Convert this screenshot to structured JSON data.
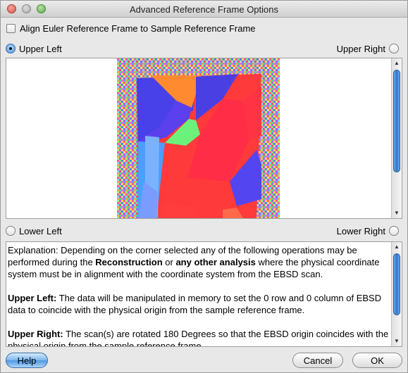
{
  "window": {
    "title": "Advanced Reference Frame Options"
  },
  "options": {
    "align_checkbox_label": "Align Euler Reference Frame to Sample Reference Frame",
    "align_checked": false
  },
  "corners": {
    "upper_left": "Upper Left",
    "upper_right": "Upper Right",
    "lower_left": "Lower Left",
    "lower_right": "Lower Right",
    "selected": "upper_left"
  },
  "explanation": {
    "intro_a": "Explanation: Depending on the corner selected any of the following operations may be performed during the ",
    "intro_b1": "Reconstruction",
    "intro_c": " or ",
    "intro_b2": "any other analysis",
    "intro_d": " where the physical coordinate system must be in alignment with the coordinate system from the EBSD scan.",
    "ul_head": "Upper Left:",
    "ul_text": " The data will be manipulated in memory to set the 0 row and 0 column of EBSD data to coincide with the physical origin from the sample reference frame.",
    "ur_head": "Upper Right:",
    "ur_text": " The scan(s) are rotated 180 Degrees so that the EBSD origin coincides with the physical origin from the sample reference frame."
  },
  "buttons": {
    "help": "Help",
    "cancel": "Cancel",
    "ok": "OK"
  },
  "colors": {
    "accent": "#4a8fd6",
    "default_button": "#7cb6ee"
  }
}
